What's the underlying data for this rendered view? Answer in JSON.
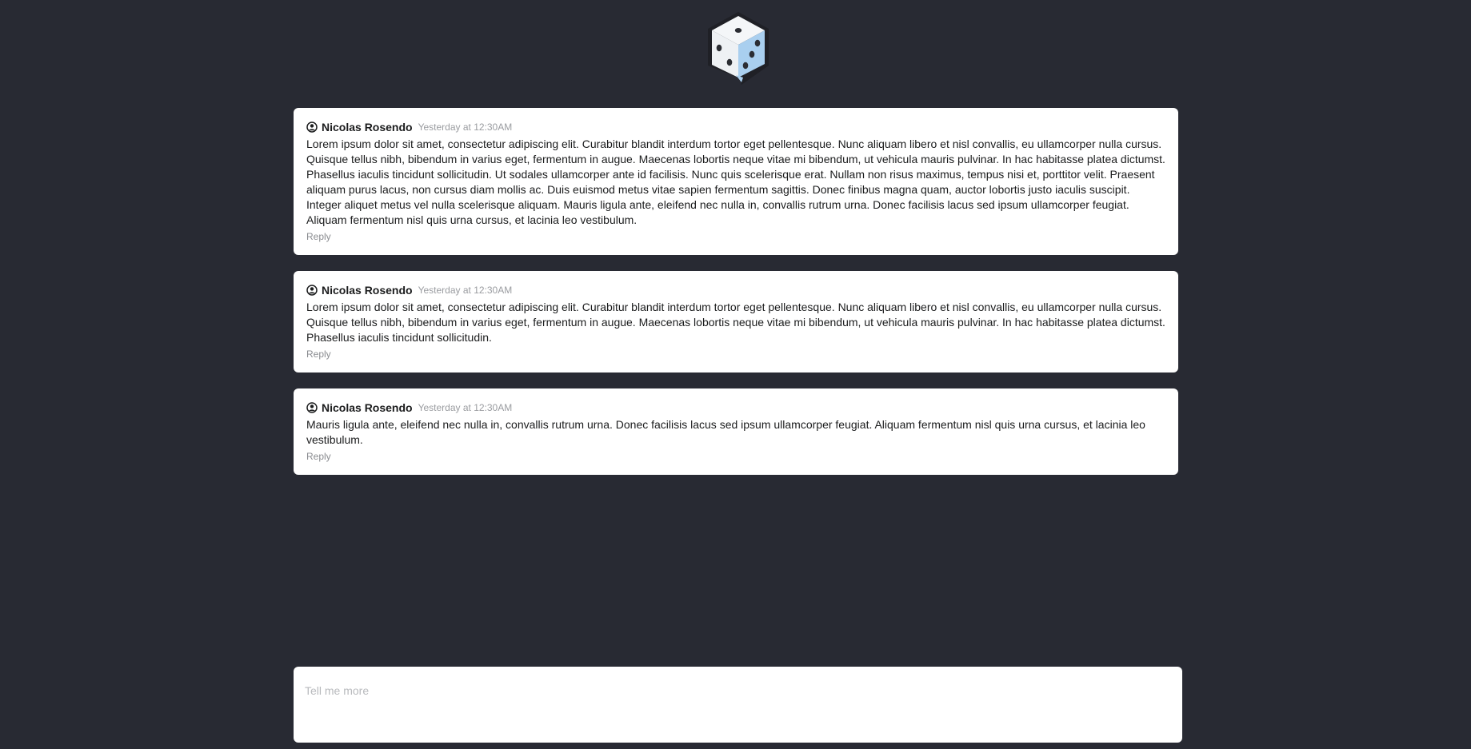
{
  "logo": {
    "icon": "dice-chat-icon",
    "colors": {
      "face": "#f4f6f8",
      "side": "#a9cfef",
      "pips": "#2b2d33"
    }
  },
  "comments": [
    {
      "author": "Nicolas Rosendo",
      "timestamp": "Yesterday at 12:30AM",
      "text": "Lorem ipsum dolor sit amet, consectetur adipiscing elit. Curabitur blandit interdum tortor eget pellentesque. Nunc aliquam libero et nisl convallis, eu ullamcorper nulla cursus. Quisque tellus nibh, bibendum in varius eget, fermentum in augue. Maecenas lobortis neque vitae mi bibendum, ut vehicula mauris pulvinar. In hac habitasse platea dictumst. Phasellus iaculis tincidunt sollicitudin. Ut sodales ullamcorper ante id facilisis. Nunc quis scelerisque erat. Nullam non risus maximus, tempus nisi et, porttitor velit. Praesent aliquam purus lacus, non cursus diam mollis ac. Duis euismod metus vitae sapien fermentum sagittis. Donec finibus magna quam, auctor lobortis justo iaculis suscipit. Integer aliquet metus vel nulla scelerisque aliquam. Mauris ligula ante, eleifend nec nulla in, convallis rutrum urna. Donec facilisis lacus sed ipsum ullamcorper feugiat. Aliquam fermentum nisl quis urna cursus, et lacinia leo vestibulum.",
      "reply_label": "Reply"
    },
    {
      "author": "Nicolas Rosendo",
      "timestamp": "Yesterday at 12:30AM",
      "text": "Lorem ipsum dolor sit amet, consectetur adipiscing elit. Curabitur blandit interdum tortor eget pellentesque. Nunc aliquam libero et nisl convallis, eu ullamcorper nulla cursus. Quisque tellus nibh, bibendum in varius eget, fermentum in augue. Maecenas lobortis neque vitae mi bibendum, ut vehicula mauris pulvinar. In hac habitasse platea dictumst. Phasellus iaculis tincidunt sollicitudin.",
      "reply_label": "Reply"
    },
    {
      "author": "Nicolas Rosendo",
      "timestamp": "Yesterday at 12:30AM",
      "text": "Mauris ligula ante, eleifend nec nulla in, convallis rutrum urna. Donec facilisis lacus sed ipsum ullamcorper feugiat. Aliquam fermentum nisl quis urna cursus, et lacinia leo vestibulum.",
      "reply_label": "Reply"
    }
  ],
  "composer": {
    "placeholder": "Tell me more",
    "value": ""
  }
}
